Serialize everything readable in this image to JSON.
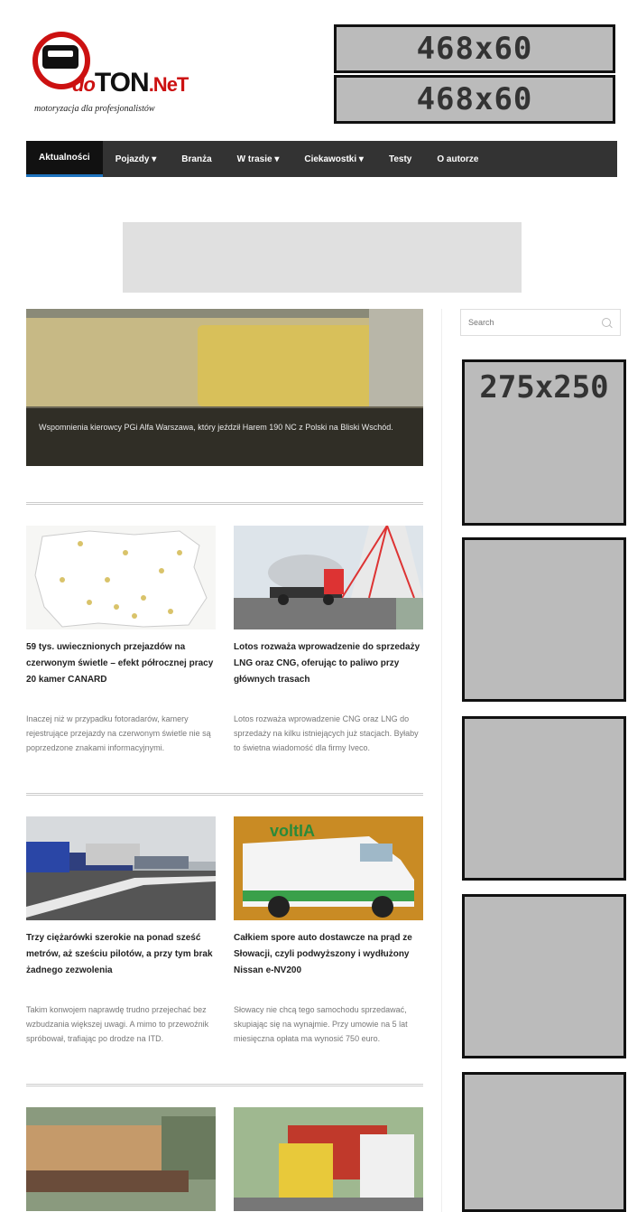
{
  "header": {
    "logo": {
      "part1": "do",
      "part2": "TON",
      "part3": ".NeT",
      "tagline": "motoryzacja dla profesjonalistów"
    },
    "ads": [
      "468x60",
      "468x60"
    ]
  },
  "nav": {
    "items": [
      {
        "label": "Aktualności",
        "active": true
      },
      {
        "label": "Pojazdy ▾"
      },
      {
        "label": "Branża"
      },
      {
        "label": "W trasie ▾"
      },
      {
        "label": "Ciekawostki ▾"
      },
      {
        "label": "Testy"
      },
      {
        "label": "O autorze"
      }
    ]
  },
  "featured": {
    "caption": "Wspomnienia kierowcy PGi Alfa Warszawa, który jeździł Harem 190 NC z Polski na Bliski Wschód."
  },
  "sidebar": {
    "search_placeholder": "Search",
    "ad_label": "275x250"
  },
  "articles": [
    {
      "title": "59 tys. uwiecznionych przejazdów na czerwonym świetle – efekt półrocznej pracy 20 kamer CANARD",
      "excerpt": "Inaczej niż w przypadku fotoradarów, kamery rejestrujące przejazdy na czerwonym świetle nie są poprzedzone znakami informacyjnymi."
    },
    {
      "title": "Lotos rozważa wprowadzenie do sprzedaży LNG oraz CNG, oferując to paliwo przy głównych trasach",
      "excerpt": "Lotos rozważa wprowadzenie CNG oraz LNG do sprzedaży na kilku istniejących już stacjach. Byłaby to świetna wiadomość dla firmy Iveco."
    },
    {
      "title": "Trzy ciężarówki szerokie na ponad sześć metrów, aż sześciu pilotów, a przy tym brak żadnego zezwolenia",
      "excerpt": "Takim konwojem naprawdę trudno przejechać bez wzbudzania większej uwagi. A mimo to przewoźnik spróbował, trafiając po drodze na ITD."
    },
    {
      "title": "Całkiem spore auto dostawcze na prąd ze Słowacji, czyli podwyższony i wydłużony Nissan e-NV200",
      "excerpt": "Słowacy nie chcą tego samochodu sprzedawać, skupiając się na wynajmie. Przy umowie na 5 lat miesięczna opłata ma wynosić 750 euro."
    }
  ],
  "image_tags": {
    "bus_brand": "voltIA"
  }
}
